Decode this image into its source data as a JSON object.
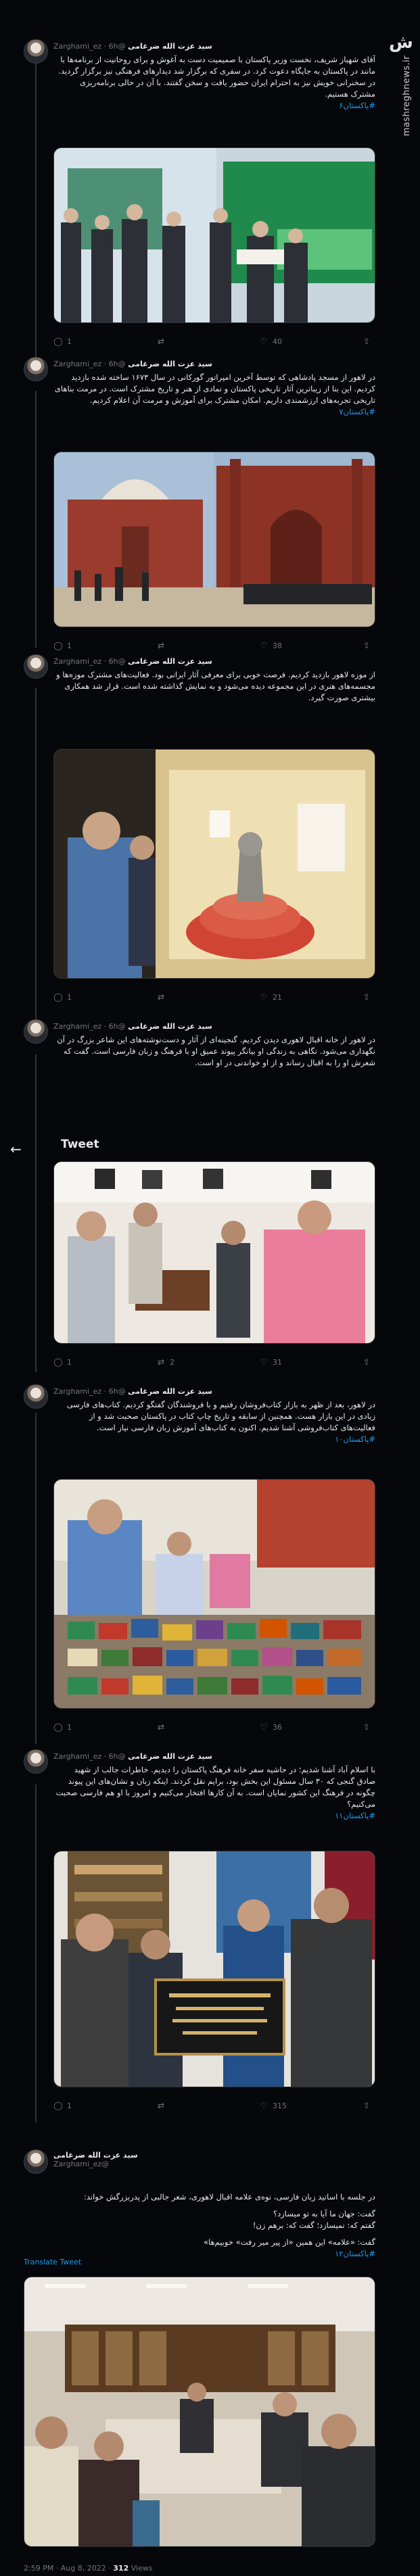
{
  "brand": {
    "name": "mashreghnews.ir"
  },
  "tweets": [
    {
      "author": "سید عزت الله ضرغامی",
      "handle": "@Zarghami_ez",
      "time": "6h",
      "text": "آقای شهباز شریف، نخست وزیر پاکستان با صمیمیت دست به آغوش و برای روحانیت از برنامه‌ها با مانند در پاکستان به جایگاه دعوت کرد. در سفری که برگزار شد دیدارهای فرهنگی نیز برگزار گردید. در سخنرانی خویش نیز به احترام ایران حضور یافت و سخن گفتند. با آن در حالی برنامه‌ریزی مشترک هستیم.",
      "hashtag": "#پاکستان۶",
      "stats": {
        "reply": "1",
        "retweet": "",
        "like": "40"
      }
    },
    {
      "author": "سید عزت الله ضرغامی",
      "handle": "@Zarghami_ez",
      "time": "6h",
      "text": "در لاهور از مسجد پادشاهی که توسط آخرین امپراتور گورکانی در سال ۱۶۷۳ ساخته شده بازدید کردیم. این بنا از زیباترین آثار تاریخی پاکستان و نمادی از هنر و تاریخ مشترک است. در مرمت بناهای تاریخی تجربه‌های ارزشمندی داریم. امکان مشترک برای آموزش و مرمت آن اعلام کردیم.",
      "hashtag": "#پاکستان۷",
      "stats": {
        "reply": "1",
        "retweet": "",
        "like": "38"
      }
    },
    {
      "author": "سید عزت الله ضرغامی",
      "handle": "@Zarghami_ez",
      "time": "6h",
      "text": "از موزه لاهور بازدید کردیم. فرصت خوبی برای معرفی آثار ایرانی بود. فعالیت‌های مشترک موزه‌ها و مجسمه‌های هنری در این مجموعه دیده می‌شود و به نمایش گذاشته شده است. قرار شد همکاری بیشتری صورت گیرد.",
      "hashtag": "",
      "stats": {
        "reply": "1",
        "retweet": "",
        "like": "21"
      }
    },
    {
      "author": "سید عزت الله ضرغامی",
      "handle": "@Zarghami_ez",
      "time": "6h",
      "text": "در لاهور از خانه اقبال لاهوری دیدن کردیم. گنجینه‌ای از آثار و دست‌نوشته‌های این شاعر بزرگ در آن نگهداری می‌شود. نگاهی به زندگی او بیانگر پیوند عمیق او با فرهنگ و زبان فارسی است. گفت که شعرش او را به اقبال رساند و از او خواندنی در او است.",
      "hashtag": "",
      "tweet_label": "Tweet",
      "stats": {
        "reply": "1",
        "retweet": "2",
        "like": "31"
      }
    },
    {
      "author": "سید عزت الله ضرغامی",
      "handle": "@Zarghami_ez",
      "time": "6h",
      "text": "در لاهور، بعد از ظهر به بازار کتاب‌فروشان رفتیم و با فروشندگان گفتگو کردیم. کتاب‌های فارسی زیادی در این بازار هست. همچنین از سابقه و تاریخ چاپ کتاب در پاکستان صحبت شد و از فعالیت‌های کتاب‌فروشی آشنا شدیم. اکنون به کتاب‌های آموزش زبان فارسی نیاز است.",
      "hashtag": "#پاکستان۱۰",
      "stats": {
        "reply": "1",
        "retweet": "",
        "like": "36"
      }
    },
    {
      "author": "سید عزت الله ضرغامی",
      "handle": "@Zarghami_ez",
      "time": "6h",
      "text": "با اسلام آباد آشنا شدیم؛ در حاشیه سفر خانه فرهنگ پاکستان را دیدیم. خاطرات جالب از شهید صادق گنجی که ۳۰ سال مسئول این بخش بود، برایم نقل کردند. اینکه زبان و نشان‌های این پیوند چگونه در فرهنگ این کشور نمایان است. به آن کارها افتخار می‌کنیم و امروز با او هم فارسی صحبت می‌کنیم؟",
      "hashtag": "#پاکستان۱۱",
      "stats": {
        "reply": "1",
        "retweet": "",
        "like": "315"
      }
    },
    {
      "author": "سید عزت الله ضرغامی",
      "handle": "@Zarghami_ez",
      "time": "",
      "text_lines": [
        "در جلسه با اساتید زبان فارسی، نوه‌ی علامه اقبال لاهوری، شعر جالبی از پدربزرگش خواند:",
        "گفت: جهان ما آیا به تو میسازد؟",
        "گفتم که: نمیسازد؛ گفت که: برهم زن!",
        "گفت: «علامه» این همین «از پیر میر رفت» خوبیم‌ها»"
      ],
      "hashtag": "#پاکستان۱۲",
      "translate": "Translate Tweet"
    }
  ],
  "footer": {
    "time": "2:59 PM · Aug 8, 2022",
    "views": "312",
    "views_label": "Views"
  }
}
